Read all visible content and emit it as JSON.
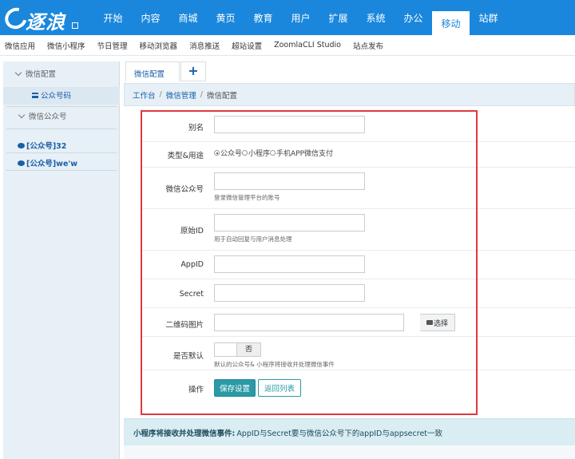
{
  "logo": {
    "text": "逐浪"
  },
  "nav": {
    "items": [
      "开始",
      "内容",
      "商城",
      "黄页",
      "教育",
      "用户",
      "扩展",
      "系统",
      "办公",
      "移动",
      "站群"
    ],
    "active": "移动"
  },
  "subnav": {
    "items": [
      "微信应用",
      "微信小程序",
      "节日管理",
      "移动浏览器",
      "消息推送",
      "超站设置",
      "ZoomlaCLI Studio",
      "站点发布"
    ]
  },
  "sidebar": {
    "group1": "微信配置",
    "active_item": "公众号码",
    "group2": "微信公众号",
    "accounts": [
      "[公众号]32",
      "[公众号]we'w"
    ]
  },
  "tabs": {
    "current": "微信配置",
    "add": "+"
  },
  "breadcrumb": {
    "items": [
      "工作台",
      "微信管理"
    ],
    "current": "微信配置",
    "sep": "/"
  },
  "form": {
    "alias_label": "别名",
    "type_label": "类型&用途",
    "type_options": [
      "公众号",
      "小程序",
      "手机APP微信支付"
    ],
    "type_selected": "公众号",
    "wxname_label": "微信公众号",
    "wxname_hint": "登录微信管理平台的账号",
    "origid_label": "原始ID",
    "origid_hint": "用于自动回复与用户消息处理",
    "appid_label": "AppID",
    "secret_label": "Secret",
    "qrcode_label": "二维码图片",
    "qrcode_button": "选择",
    "default_label": "是否默认",
    "default_value": "否",
    "default_hint": "默认的公众号& 小程序将接收并处理微信事件",
    "action_label": "操作",
    "save_button": "保存设置",
    "back_button": "返回列表"
  },
  "notice": {
    "bold": "小程序将接收并处理微信事件:",
    "text": " AppID与Secret要与微信公众号下的appID与appsecret一致"
  },
  "colors": {
    "accent": "#1a87dc",
    "primary_btn": "#2a9aa6",
    "highlight_box": "#e0393e"
  }
}
